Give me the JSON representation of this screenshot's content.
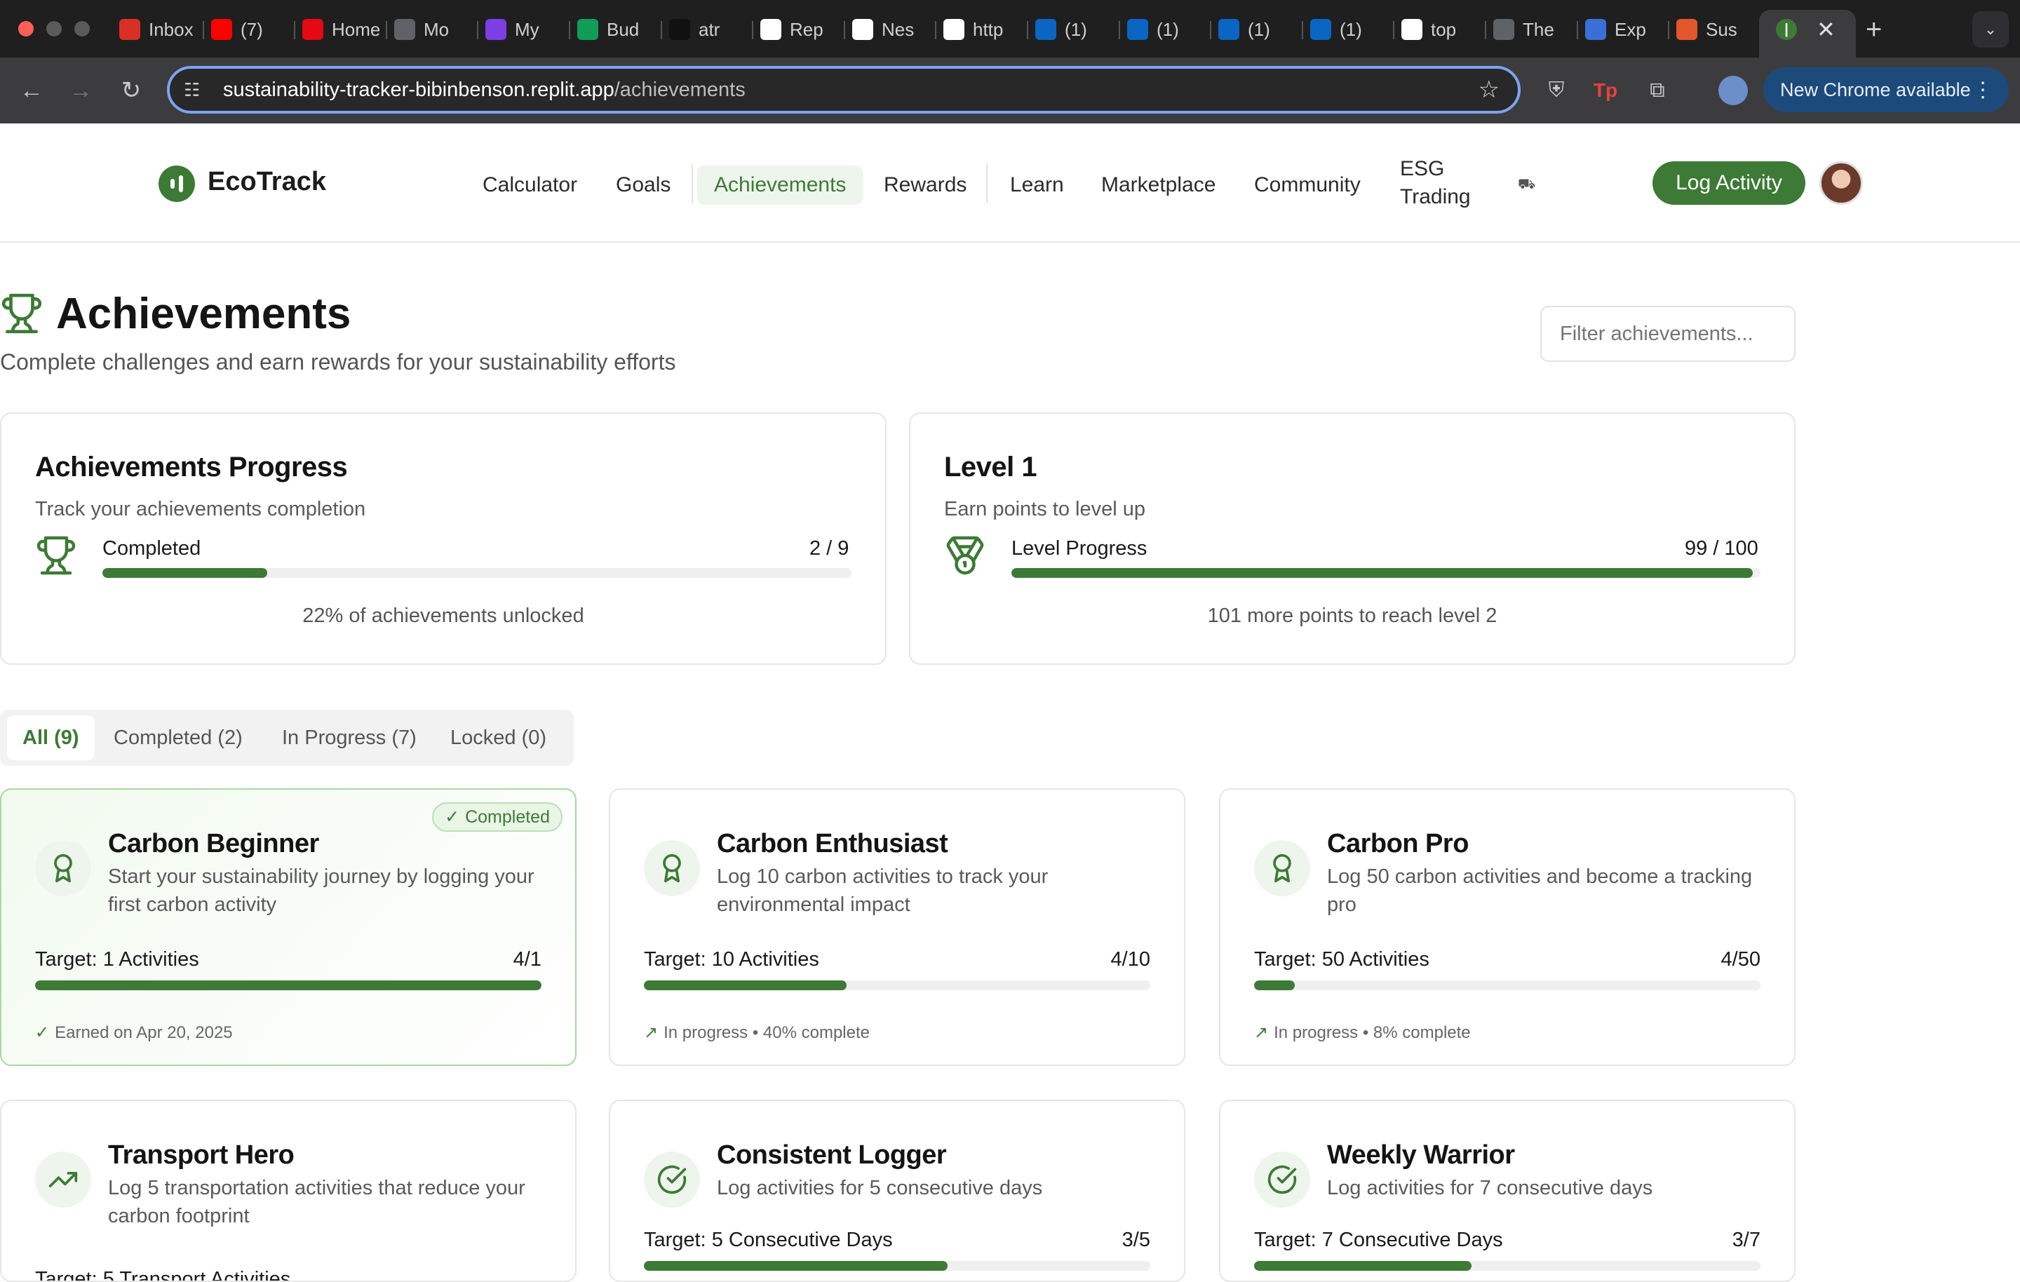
{
  "browser": {
    "tabs": [
      {
        "title": "Inbox",
        "icon": "gmail-icon",
        "color": "#d93025"
      },
      {
        "title": "(7)",
        "icon": "youtube-icon",
        "color": "#ff0000"
      },
      {
        "title": "Home",
        "icon": "netflix-icon",
        "color": "#e50914"
      },
      {
        "title": "Mo",
        "icon": "globe-icon",
        "color": "#5f6368"
      },
      {
        "title": "My",
        "icon": "app-icon",
        "color": "#7b3fe4"
      },
      {
        "title": "Bud",
        "icon": "sheets-icon",
        "color": "#0f9d58"
      },
      {
        "title": "atr",
        "icon": "app-icon",
        "color": "#111111"
      },
      {
        "title": "Rep",
        "icon": "openai-icon",
        "color": "#ffffff"
      },
      {
        "title": "Nes",
        "icon": "doc-icon",
        "color": "#ffffff"
      },
      {
        "title": "http",
        "icon": "app-icon",
        "color": "#ffffff"
      },
      {
        "title": "(1)",
        "icon": "linkedin-icon",
        "color": "#0a66c2"
      },
      {
        "title": "(1)",
        "icon": "linkedin-icon",
        "color": "#0a66c2"
      },
      {
        "title": "(1)",
        "icon": "linkedin-icon",
        "color": "#0a66c2"
      },
      {
        "title": "(1)",
        "icon": "linkedin-icon",
        "color": "#0a66c2"
      },
      {
        "title": "top",
        "icon": "google-icon",
        "color": "#ffffff"
      },
      {
        "title": "The",
        "icon": "app-icon",
        "color": "#5f6368"
      },
      {
        "title": "Exp",
        "icon": "app-icon",
        "color": "#3b6fd8"
      },
      {
        "title": "Sus",
        "icon": "app-icon",
        "color": "#e2572b"
      }
    ],
    "url_host": "sustainability-tracker-bibinbenson.replit.app",
    "url_path": "/achievements",
    "new_chrome_label": "New Chrome available"
  },
  "header": {
    "brand": "EcoTrack",
    "nav": [
      "Calculator",
      "Goals",
      "Achievements",
      "Rewards",
      "Learn",
      "Marketplace",
      "Community",
      "ESG Trading"
    ],
    "active_nav": "Achievements",
    "log_activity_label": "Log Activity"
  },
  "page": {
    "title": "Achievements",
    "subtitle": "Complete challenges and earn rewards for your sustainability efforts",
    "filter_placeholder": "Filter achievements..."
  },
  "progress_card": {
    "title": "Achievements Progress",
    "subtitle": "Track your achievements completion",
    "label": "Completed",
    "value": "2 / 9",
    "fraction": 0.22,
    "note": "22% of achievements unlocked"
  },
  "level_card": {
    "title": "Level 1",
    "subtitle": "Earn points to level up",
    "label": "Level Progress",
    "value": "99 / 100",
    "fraction": 0.99,
    "note": "101 more points to reach level 2"
  },
  "filter_tabs": [
    {
      "label": "All (9)",
      "active": true
    },
    {
      "label": "Completed (2)",
      "active": false
    },
    {
      "label": "In Progress (7)",
      "active": false
    },
    {
      "label": "Locked (0)",
      "active": false
    }
  ],
  "achievements": [
    {
      "title": "Carbon Beginner",
      "desc": "Start your sustainability journey by logging your first carbon activity",
      "target": "Target: 1 Activities",
      "count": "4/1",
      "fraction": 1.0,
      "status": "Earned on Apr 20, 2025",
      "completed": true,
      "badge": "Completed",
      "icon": "award-icon"
    },
    {
      "title": "Carbon Enthusiast",
      "desc": "Log 10 carbon activities to track your environmental impact",
      "target": "Target: 10 Activities",
      "count": "4/10",
      "fraction": 0.4,
      "status": "In progress • 40% complete",
      "completed": false,
      "icon": "award-icon"
    },
    {
      "title": "Carbon Pro",
      "desc": "Log 50 carbon activities and become a tracking pro",
      "target": "Target: 50 Activities",
      "count": "4/50",
      "fraction": 0.08,
      "status": "In progress • 8% complete",
      "completed": false,
      "icon": "award-icon"
    },
    {
      "title": "Transport Hero",
      "desc": "Log 5 transportation activities that reduce your carbon footprint",
      "target": "",
      "count": "",
      "fraction": 0,
      "status": "",
      "completed": false,
      "icon": "trending-up-icon"
    },
    {
      "title": "Consistent Logger",
      "desc": "Log activities for 5 consecutive days",
      "target": "Target: 5 Consecutive Days",
      "count": "3/5",
      "fraction": 0.6,
      "status": "",
      "completed": false,
      "icon": "check-circle-icon"
    },
    {
      "title": "Weekly Warrior",
      "desc": "Log activities for 7 consecutive days",
      "target": "Target: 7 Consecutive Days",
      "count": "3/7",
      "fraction": 0.43,
      "status": "",
      "completed": false,
      "icon": "check-circle-icon"
    }
  ]
}
